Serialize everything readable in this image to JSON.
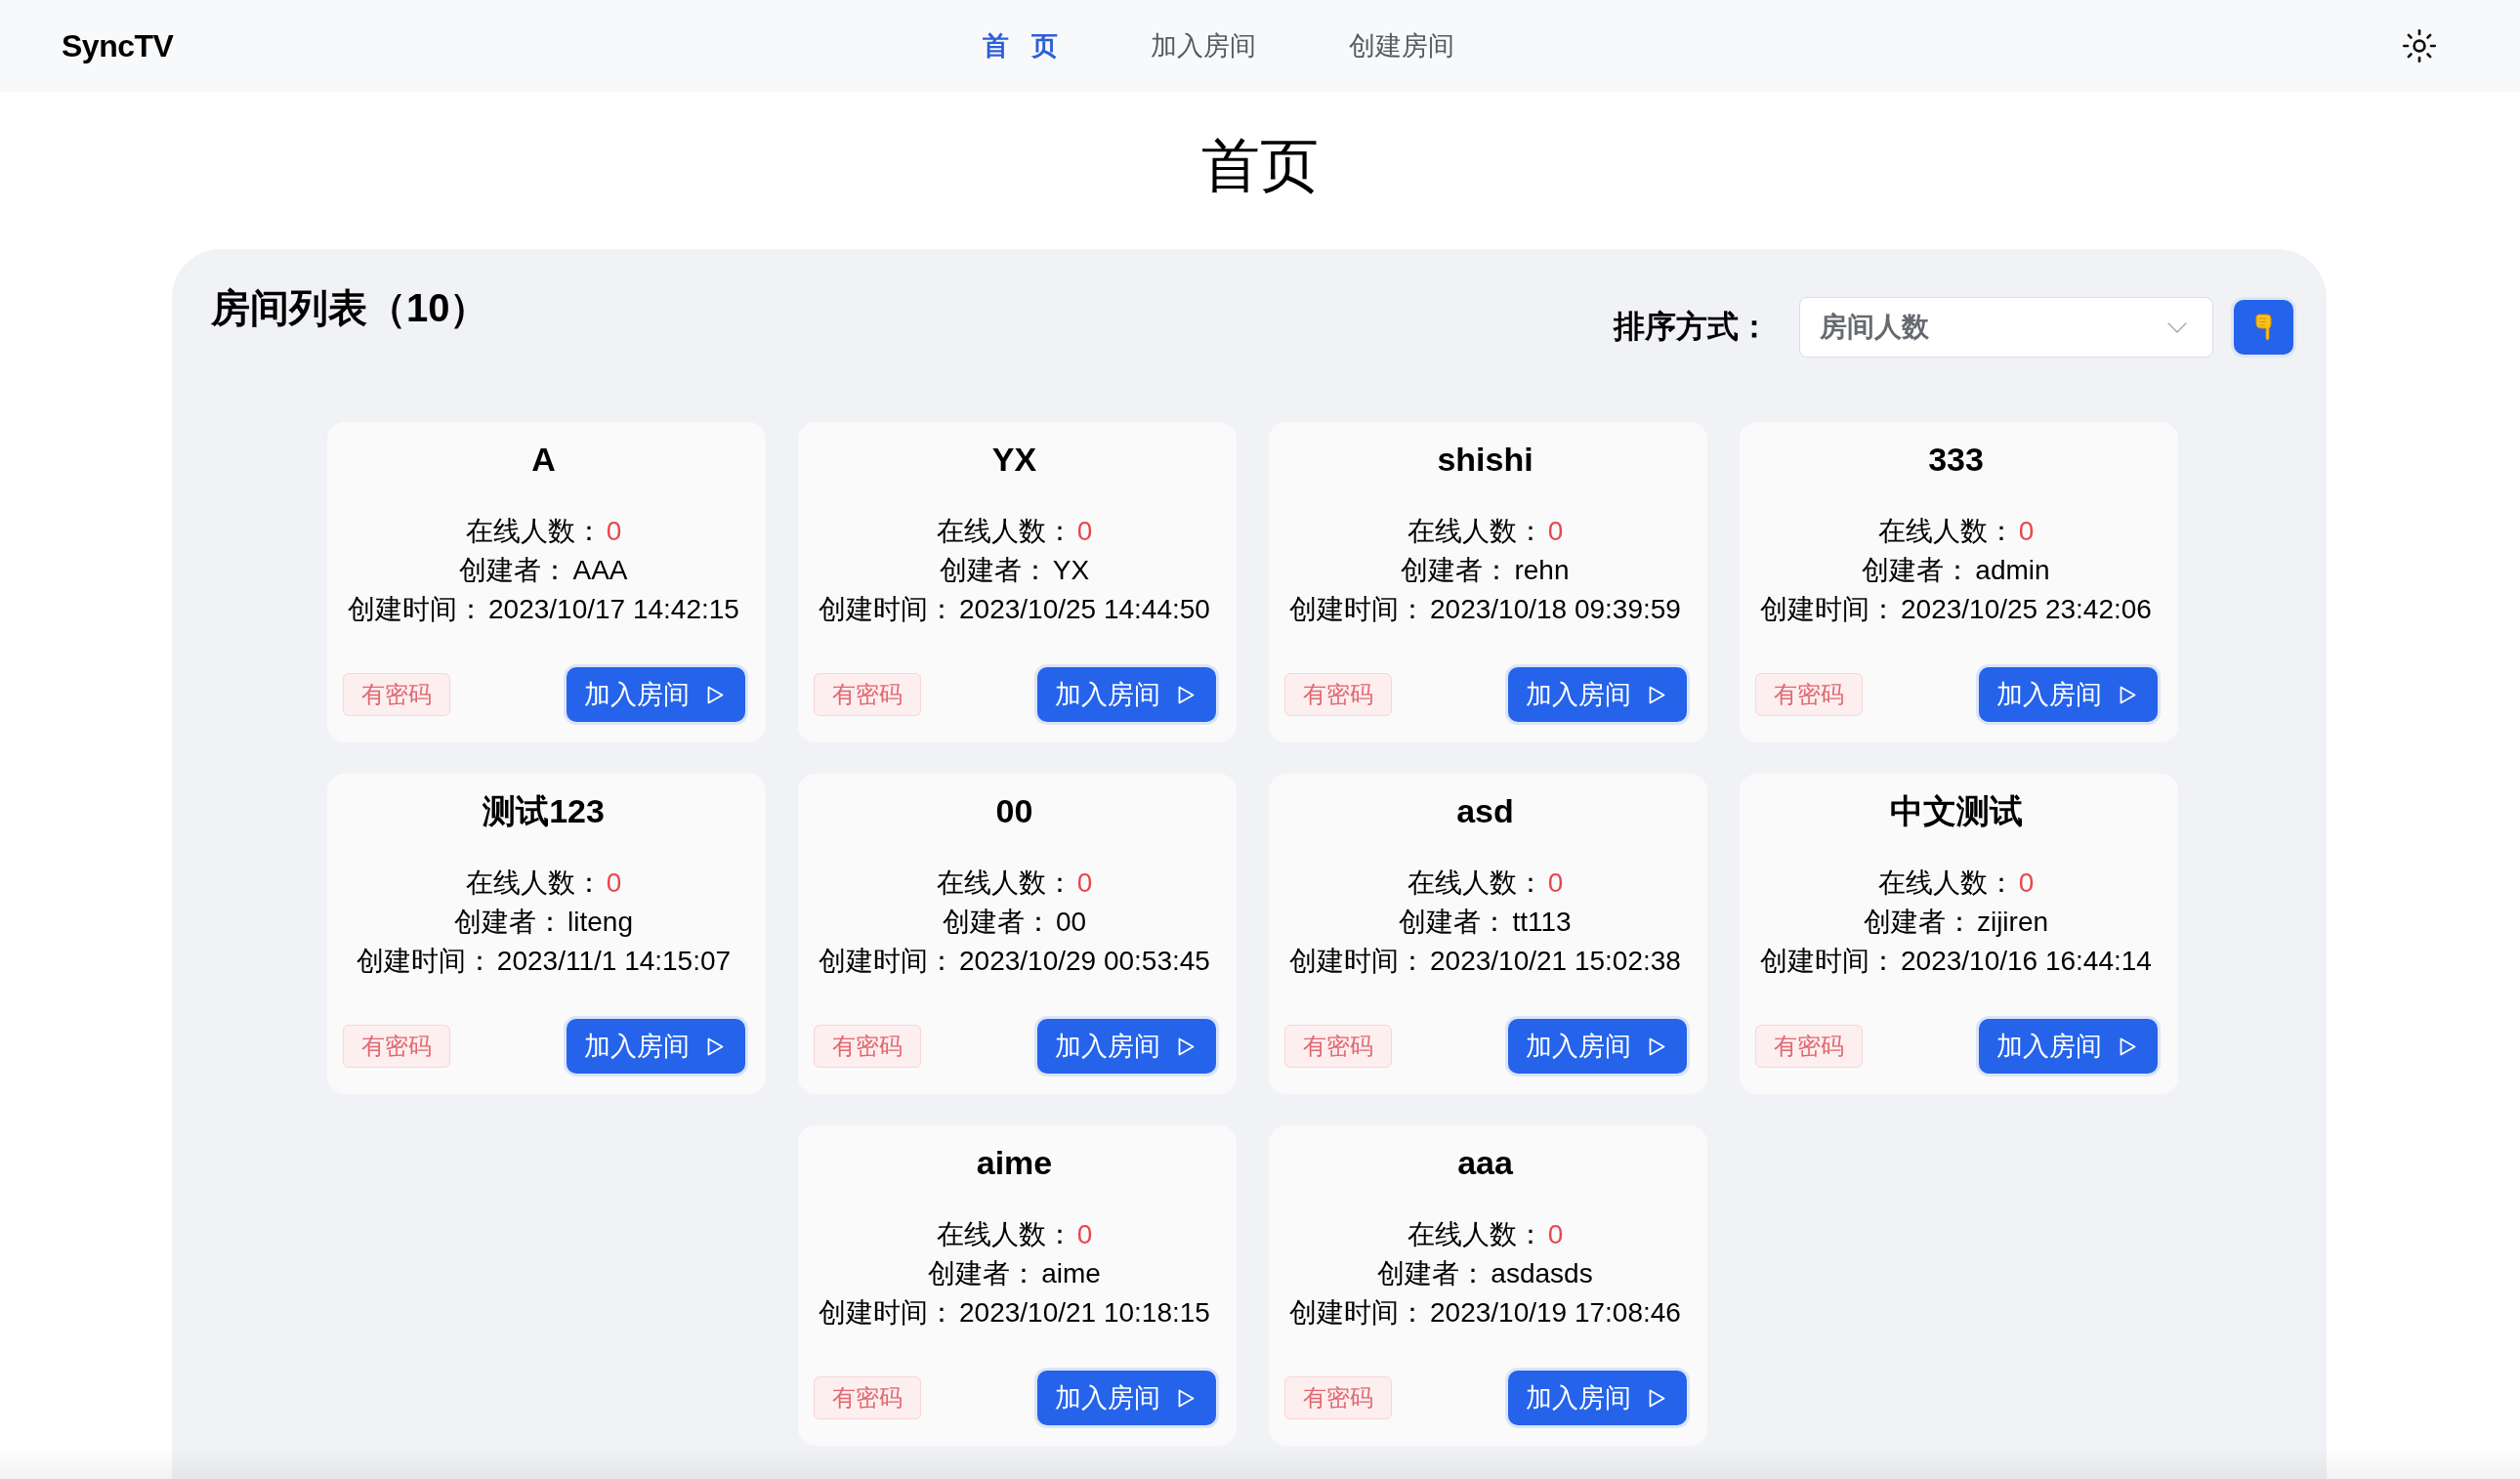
{
  "header": {
    "logo": "SyncTV",
    "nav": [
      {
        "label": "首 页",
        "selected": true
      },
      {
        "label": "加入房间",
        "selected": false
      },
      {
        "label": "创建房间",
        "selected": false
      }
    ]
  },
  "page_title": "首页",
  "room_list": {
    "title": "房间列表（10）",
    "sort": {
      "label": "排序方式：",
      "value": "房间人数"
    },
    "rooms": [
      {
        "name": "A",
        "online_label": "在线人数：",
        "online": "0",
        "creator_label": "创建者：",
        "creator": "AAA",
        "created_label": "创建时间：",
        "created": "2023/10/17 14:42:15",
        "tag": "有密码",
        "join": "加入房间"
      },
      {
        "name": "YX",
        "online_label": "在线人数：",
        "online": "0",
        "creator_label": "创建者：",
        "creator": "YX",
        "created_label": "创建时间：",
        "created": "2023/10/25 14:44:50",
        "tag": "有密码",
        "join": "加入房间"
      },
      {
        "name": "shishi",
        "online_label": "在线人数：",
        "online": "0",
        "creator_label": "创建者：",
        "creator": "rehn",
        "created_label": "创建时间：",
        "created": "2023/10/18 09:39:59",
        "tag": "有密码",
        "join": "加入房间"
      },
      {
        "name": "333",
        "online_label": "在线人数：",
        "online": "0",
        "creator_label": "创建者：",
        "creator": "admin",
        "created_label": "创建时间：",
        "created": "2023/10/25 23:42:06",
        "tag": "有密码",
        "join": "加入房间"
      },
      {
        "name": "测试123",
        "online_label": "在线人数：",
        "online": "0",
        "creator_label": "创建者：",
        "creator": "liteng",
        "created_label": "创建时间：",
        "created": "2023/11/1 14:15:07",
        "tag": "有密码",
        "join": "加入房间"
      },
      {
        "name": "00",
        "online_label": "在线人数：",
        "online": "0",
        "creator_label": "创建者：",
        "creator": "00",
        "created_label": "创建时间：",
        "created": "2023/10/29 00:53:45",
        "tag": "有密码",
        "join": "加入房间"
      },
      {
        "name": "asd",
        "online_label": "在线人数：",
        "online": "0",
        "creator_label": "创建者：",
        "creator": "tt113",
        "created_label": "创建时间：",
        "created": "2023/10/21 15:02:38",
        "tag": "有密码",
        "join": "加入房间"
      },
      {
        "name": "中文测试",
        "online_label": "在线人数：",
        "online": "0",
        "creator_label": "创建者：",
        "creator": "zijiren",
        "created_label": "创建时间：",
        "created": "2023/10/16 16:44:14",
        "tag": "有密码",
        "join": "加入房间"
      },
      {
        "name": "aime",
        "online_label": "在线人数：",
        "online": "0",
        "creator_label": "创建者：",
        "creator": "aime",
        "created_label": "创建时间：",
        "created": "2023/10/21 10:18:15",
        "tag": "有密码",
        "join": "加入房间"
      },
      {
        "name": "aaa",
        "online_label": "在线人数：",
        "online": "0",
        "creator_label": "创建者：",
        "creator": "asdasds",
        "created_label": "创建时间：",
        "created": "2023/10/19 17:08:46",
        "tag": "有密码",
        "join": "加入房间"
      }
    ]
  }
}
